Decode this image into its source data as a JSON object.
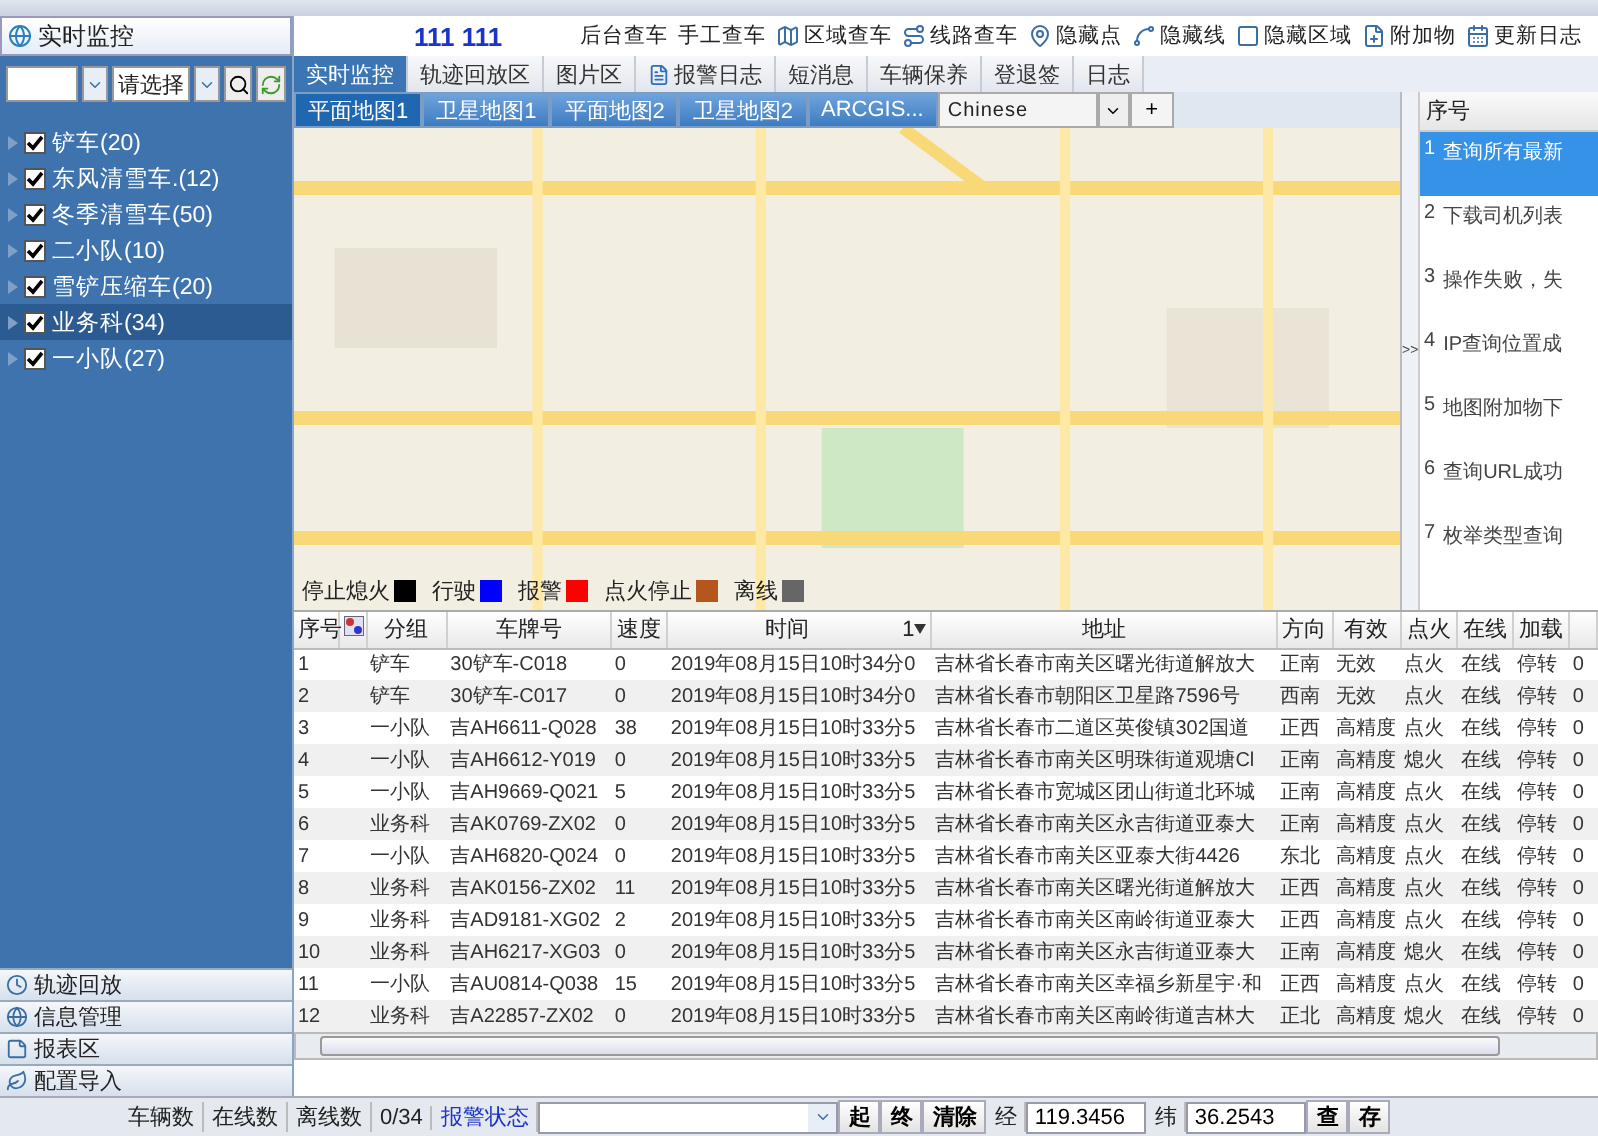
{
  "sidebar": {
    "title": "实时监控",
    "filter_select": "请选择",
    "groups": [
      {
        "label": "铲车(20)",
        "checked": true,
        "selected": false
      },
      {
        "label": "东风清雪车.(12)",
        "checked": true,
        "selected": false
      },
      {
        "label": "冬季清雪车(50)",
        "checked": true,
        "selected": false
      },
      {
        "label": "二小队(10)",
        "checked": true,
        "selected": false
      },
      {
        "label": "雪铲压缩车(20)",
        "checked": true,
        "selected": false
      },
      {
        "label": "业务科(34)",
        "checked": true,
        "selected": true
      },
      {
        "label": "一小队(27)",
        "checked": true,
        "selected": false
      }
    ],
    "sections": [
      "轨迹回放",
      "信息管理",
      "报表区",
      "配置导入"
    ]
  },
  "header": {
    "user": "111 111",
    "tools": [
      {
        "label": "后台查车",
        "kind": "plain"
      },
      {
        "label": "手工查车",
        "kind": "plain"
      },
      {
        "label": "区域查车",
        "kind": "icon"
      },
      {
        "label": "线路查车",
        "kind": "icon"
      },
      {
        "label": "隐藏点",
        "kind": "icon"
      },
      {
        "label": "隐藏线",
        "kind": "icon"
      },
      {
        "label": "隐藏区域",
        "kind": "icon"
      },
      {
        "label": "附加物",
        "kind": "icon"
      },
      {
        "label": "更新日志",
        "kind": "icon"
      }
    ]
  },
  "tabs": [
    {
      "label": "实时监控",
      "selected": true,
      "kind": "plain"
    },
    {
      "label": "轨迹回放区",
      "selected": false,
      "kind": "plain"
    },
    {
      "label": "图片区",
      "selected": false,
      "kind": "plain"
    },
    {
      "label": "报警日志",
      "selected": false,
      "kind": "icon"
    },
    {
      "label": "短消息",
      "selected": false,
      "kind": "plain"
    },
    {
      "label": "车辆保养",
      "selected": false,
      "kind": "plain"
    },
    {
      "label": "登退签",
      "selected": false,
      "kind": "plain"
    },
    {
      "label": "日志",
      "selected": false,
      "kind": "plain"
    }
  ],
  "map_tabs": [
    {
      "label": "平面地图1",
      "selected": true
    },
    {
      "label": "卫星地图1",
      "selected": false
    },
    {
      "label": "平面地图2",
      "selected": false
    },
    {
      "label": "卫星地图2",
      "selected": false
    },
    {
      "label": "ARCGIS...",
      "selected": false
    }
  ],
  "map_language": "Chinese",
  "add_tab": "+",
  "legend": [
    {
      "label": "停止熄火",
      "color": "#000000"
    },
    {
      "label": "行驶",
      "color": "#0000ff"
    },
    {
      "label": "报警",
      "color": "#ff0000"
    },
    {
      "label": "点火停止",
      "color": "#b5561c"
    },
    {
      "label": "离线",
      "color": "#666666"
    }
  ],
  "messages": {
    "toggle": ">>",
    "column": "序号",
    "rows": [
      {
        "index": "1",
        "text": "查询所有最新",
        "selected": true
      },
      {
        "index": "2",
        "text": "下载司机列表",
        "selected": false
      },
      {
        "index": "3",
        "text": "操作失败，失",
        "selected": false
      },
      {
        "index": "4",
        "text": "IP查询位置成",
        "selected": false
      },
      {
        "index": "5",
        "text": "地图附加物下",
        "selected": false
      },
      {
        "index": "6",
        "text": "查询URL成功",
        "selected": false
      },
      {
        "index": "7",
        "text": "枚举类型查询",
        "selected": false
      }
    ]
  },
  "table": {
    "columns": [
      "序号",
      "分组",
      "车牌号",
      "速度",
      "时间",
      "地址",
      "方向",
      "有效",
      "点火",
      "在线",
      "加载"
    ],
    "sort_order": "1",
    "rows": [
      [
        "1",
        "铲车",
        "30铲车-C018",
        "0",
        "2019年08月15日10时34分0",
        "吉林省长春市南关区曙光街道解放大",
        "正南",
        "无效",
        "点火",
        "在线",
        "停转",
        "0"
      ],
      [
        "2",
        "铲车",
        "30铲车-C017",
        "0",
        "2019年08月15日10时34分0",
        "吉林省长春市朝阳区卫星路7596号",
        "西南",
        "无效",
        "点火",
        "在线",
        "停转",
        "0"
      ],
      [
        "3",
        "一小队",
        "吉AH6611-Q028",
        "38",
        "2019年08月15日10时33分5",
        "吉林省长春市二道区英俊镇302国道",
        "正西",
        "高精度",
        "点火",
        "在线",
        "停转",
        "0"
      ],
      [
        "4",
        "一小队",
        "吉AH6612-Y019",
        "0",
        "2019年08月15日10时33分5",
        "吉林省长春市南关区明珠街道观塘Cl",
        "正南",
        "高精度",
        "熄火",
        "在线",
        "停转",
        "0"
      ],
      [
        "5",
        "一小队",
        "吉AH9669-Q021",
        "5",
        "2019年08月15日10时33分5",
        "吉林省长春市宽城区团山街道北环城",
        "正南",
        "高精度",
        "点火",
        "在线",
        "停转",
        "0"
      ],
      [
        "6",
        "业务科",
        "吉AK0769-ZX02",
        "0",
        "2019年08月15日10时33分5",
        "吉林省长春市南关区永吉街道亚泰大",
        "正南",
        "高精度",
        "点火",
        "在线",
        "停转",
        "0"
      ],
      [
        "7",
        "一小队",
        "吉AH6820-Q024",
        "0",
        "2019年08月15日10时33分5",
        "吉林省长春市南关区亚泰大街4426",
        "东北",
        "高精度",
        "点火",
        "在线",
        "停转",
        "0"
      ],
      [
        "8",
        "业务科",
        "吉AK0156-ZX02",
        "11",
        "2019年08月15日10时33分5",
        "吉林省长春市南关区曙光街道解放大",
        "正西",
        "高精度",
        "点火",
        "在线",
        "停转",
        "0"
      ],
      [
        "9",
        "业务科",
        "吉AD9181-XG02",
        "2",
        "2019年08月15日10时33分5",
        "吉林省长春市南关区南岭街道亚泰大",
        "正西",
        "高精度",
        "点火",
        "在线",
        "停转",
        "0"
      ],
      [
        "10",
        "业务科",
        "吉AH6217-XG03",
        "0",
        "2019年08月15日10时33分5",
        "吉林省长春市南关区永吉街道亚泰大",
        "正南",
        "高精度",
        "熄火",
        "在线",
        "停转",
        "0"
      ],
      [
        "11",
        "一小队",
        "吉AU0814-Q038",
        "15",
        "2019年08月15日10时33分5",
        "吉林省长春市南关区幸福乡新星宇·和",
        "正西",
        "高精度",
        "点火",
        "在线",
        "停转",
        "0"
      ],
      [
        "12",
        "业务科",
        "吉A22857-ZX02",
        "0",
        "2019年08月15日10时33分5",
        "吉林省长春市南关区南岭街道吉林大",
        "正北",
        "高精度",
        "熄火",
        "在线",
        "停转",
        "0"
      ]
    ]
  },
  "status_bar": {
    "vehicles": "车辆数",
    "online": "在线数",
    "offline": "离线数",
    "count": "0/34",
    "alarm": "报警状态",
    "track_buttons": [
      "起",
      "终",
      "清除"
    ],
    "lng_label": "经",
    "lng": "119.3456",
    "lat_label": "纬",
    "lat": "36.2543",
    "action_buttons": [
      "查",
      "存"
    ]
  }
}
